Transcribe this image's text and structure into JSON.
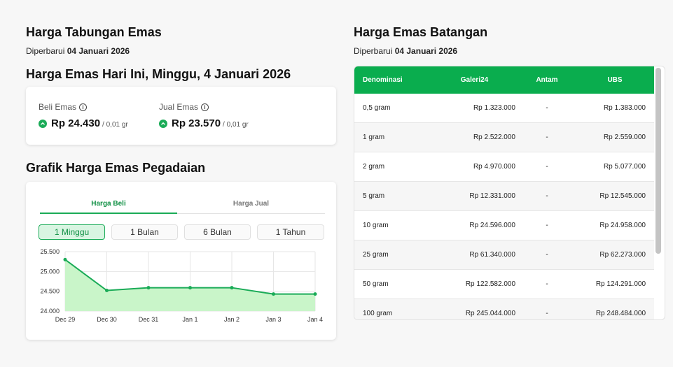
{
  "savings": {
    "title": "Harga Tabungan Emas",
    "updated_prefix": "Diperbarui",
    "updated_date": "04 Januari 2026"
  },
  "today": {
    "title": "Harga Emas Hari Ini, Minggu, 4 Januari 2026",
    "buy": {
      "label": "Beli Emas",
      "value": "Rp 24.430",
      "unit": "/ 0,01 gr"
    },
    "sell": {
      "label": "Jual Emas",
      "value": "Rp 23.570",
      "unit": "/ 0,01 gr"
    }
  },
  "chart_section": {
    "title": "Grafik Harga Emas Pegadaian",
    "tabs": [
      "Harga Beli",
      "Harga Jual"
    ],
    "active_tab": "Harga Beli",
    "ranges": [
      "1 Minggu",
      "1 Bulan",
      "6 Bulan",
      "1 Tahun"
    ],
    "active_range": "1 Minggu"
  },
  "chart_data": {
    "type": "area",
    "x": [
      "Dec 29",
      "Dec 30",
      "Dec 31",
      "Jan 1",
      "Jan 2",
      "Jan 3",
      "Jan 4"
    ],
    "values": [
      25300,
      24520,
      24590,
      24590,
      24590,
      24430,
      24430
    ],
    "ylim": [
      24000,
      25500
    ],
    "yticks": [
      24000,
      24500,
      25000,
      25500
    ],
    "ytick_labels": [
      "24.000",
      "24.500",
      "25.000",
      "25.500"
    ],
    "grid": true,
    "line_color": "#1aab57",
    "fill_color": "#c9f5c9"
  },
  "bars": {
    "title": "Harga Emas Batangan",
    "updated_prefix": "Diperbarui",
    "updated_date": "04 Januari 2026",
    "headers": [
      "Denominasi",
      "Galeri24",
      "Antam",
      "UBS"
    ],
    "rows": [
      [
        "0,5 gram",
        "Rp 1.323.000",
        "-",
        "Rp 1.383.000"
      ],
      [
        "1 gram",
        "Rp 2.522.000",
        "-",
        "Rp 2.559.000"
      ],
      [
        "2 gram",
        "Rp 4.970.000",
        "-",
        "Rp 5.077.000"
      ],
      [
        "5 gram",
        "Rp 12.331.000",
        "-",
        "Rp 12.545.000"
      ],
      [
        "10 gram",
        "Rp 24.596.000",
        "-",
        "Rp 24.958.000"
      ],
      [
        "25 gram",
        "Rp 61.340.000",
        "-",
        "Rp 62.273.000"
      ],
      [
        "50 gram",
        "Rp 122.582.000",
        "-",
        "Rp 124.291.000"
      ],
      [
        "100 gram",
        "Rp 245.044.000",
        "-",
        "Rp 248.484.000"
      ]
    ]
  },
  "colors": {
    "accent": "#0aad4e",
    "up": "#1aab57"
  }
}
